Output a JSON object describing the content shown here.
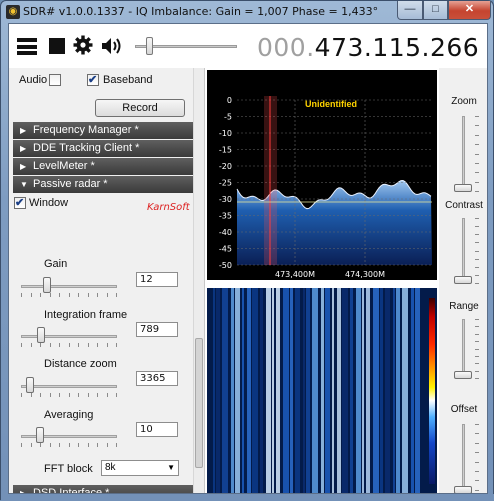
{
  "window": {
    "title": "SDR# v1.0.0.1337 - IQ Imbalance: Gain = 1,007 Phase = 1,433°",
    "app_icon": "sdr-app-icon",
    "minimize_glyph": "—",
    "maximize_glyph": "□",
    "close_glyph": "✕"
  },
  "toolbar": {
    "menu_icon": "hamburger-menu-icon",
    "stop_icon": "stop-icon",
    "settings_icon": "gear-icon",
    "audio_icon": "speaker-icon",
    "volume_level": 0.12,
    "frequency_dim": "000.",
    "frequency_main": "473.115.266"
  },
  "left_panel": {
    "audio_label": "Audio",
    "audio_checked": false,
    "baseband_label": "Baseband",
    "baseband_checked": true,
    "record_button": "Record",
    "sections": [
      {
        "label": "Frequency Manager *",
        "arrow": "▶",
        "expanded": false
      },
      {
        "label": "DDE Tracking Client *",
        "arrow": "▶",
        "expanded": false
      },
      {
        "label": "LevelMeter *",
        "arrow": "▶",
        "expanded": false
      },
      {
        "label": "Passive radar *",
        "arrow": "▼",
        "expanded": true
      }
    ],
    "passive_radar": {
      "window_label": "Window",
      "window_checked": true,
      "brand": "KarnSoft",
      "gain_label": "Gain",
      "gain_value": "12",
      "gain_level": 0.25,
      "integration_label": "Integration frame",
      "integration_value": "789",
      "integration_level": 0.18,
      "distance_label": "Distance zoom",
      "distance_value": "3365",
      "distance_level": 0.06,
      "averaging_label": "Averaging",
      "averaging_value": "10",
      "averaging_level": 0.17,
      "fft_label": "FFT block",
      "fft_value": "8k"
    },
    "bottom_section": {
      "label": "DSD Interface *",
      "arrow": "▶"
    }
  },
  "spectrum": {
    "mode_label": "Unidentified",
    "y_ticks": [
      "0",
      "-5",
      "-10",
      "-15",
      "-20",
      "-25",
      "-30",
      "-35",
      "-40",
      "-45",
      "-50"
    ],
    "x_ticks": [
      "473,400M",
      "474,300M"
    ],
    "colors": {
      "background": "#000000",
      "fill": "#1f5fb0",
      "grid": "#6b6b6b",
      "label": "#ffd400",
      "cursor": "#ff3b3b"
    }
  },
  "right_panel": {
    "zoom_label": "Zoom",
    "contrast_label": "Contrast",
    "range_label": "Range",
    "offset_label": "Offset",
    "zoom_level": 0.0,
    "contrast_level": 0.0,
    "range_level": 0.0,
    "offset_level": 0.0
  }
}
